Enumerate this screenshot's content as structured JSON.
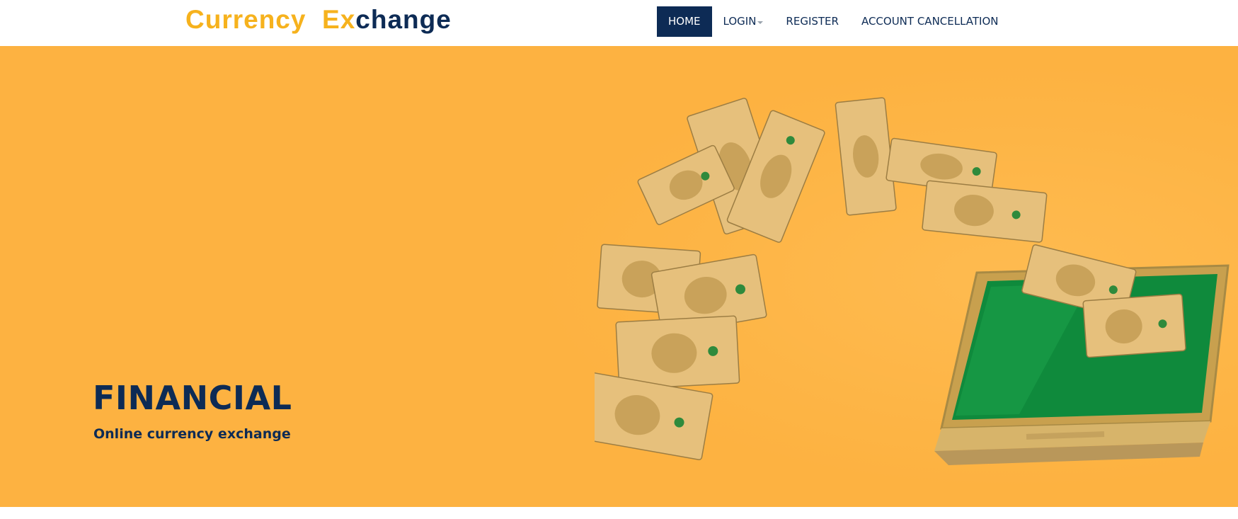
{
  "brand": {
    "part1": "Currency",
    "part2": "Ex",
    "part3": "change"
  },
  "nav": {
    "items": [
      {
        "label": "HOME",
        "active": true
      },
      {
        "label": "LOGIN",
        "dropdown": true
      },
      {
        "label": "REGISTER"
      },
      {
        "label": "ACCOUNT CANCELLATION"
      }
    ]
  },
  "hero": {
    "title": "FINANCIAL",
    "subtitle": "Online currency exchange",
    "image_icon": "money-flying-into-laptop-illustration"
  },
  "colors": {
    "primary": "#0d2b55",
    "accent": "#f6b21d",
    "hero_bg": "#fdb241"
  }
}
